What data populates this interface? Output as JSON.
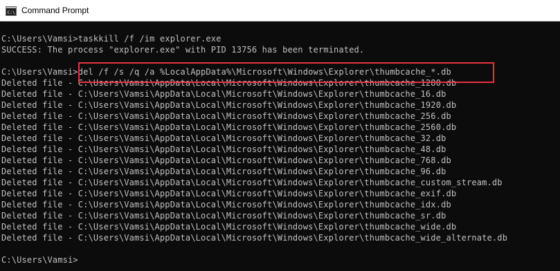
{
  "window": {
    "title": "Command Prompt",
    "icon": "cmd-icon",
    "highlight_color": "#e8323e"
  },
  "console": {
    "lines": [
      "",
      "C:\\Users\\Vamsi>taskkill /f /im explorer.exe",
      "SUCCESS: The process \"explorer.exe\" with PID 13756 has been terminated.",
      "",
      "C:\\Users\\Vamsi>del /f /s /q /a %LocalAppData%\\Microsoft\\Windows\\Explorer\\thumbcache_*.db",
      "Deleted file - C:\\Users\\Vamsi\\AppData\\Local\\Microsoft\\Windows\\Explorer\\thumbcache_1280.db",
      "Deleted file - C:\\Users\\Vamsi\\AppData\\Local\\Microsoft\\Windows\\Explorer\\thumbcache_16.db",
      "Deleted file - C:\\Users\\Vamsi\\AppData\\Local\\Microsoft\\Windows\\Explorer\\thumbcache_1920.db",
      "Deleted file - C:\\Users\\Vamsi\\AppData\\Local\\Microsoft\\Windows\\Explorer\\thumbcache_256.db",
      "Deleted file - C:\\Users\\Vamsi\\AppData\\Local\\Microsoft\\Windows\\Explorer\\thumbcache_2560.db",
      "Deleted file - C:\\Users\\Vamsi\\AppData\\Local\\Microsoft\\Windows\\Explorer\\thumbcache_32.db",
      "Deleted file - C:\\Users\\Vamsi\\AppData\\Local\\Microsoft\\Windows\\Explorer\\thumbcache_48.db",
      "Deleted file - C:\\Users\\Vamsi\\AppData\\Local\\Microsoft\\Windows\\Explorer\\thumbcache_768.db",
      "Deleted file - C:\\Users\\Vamsi\\AppData\\Local\\Microsoft\\Windows\\Explorer\\thumbcache_96.db",
      "Deleted file - C:\\Users\\Vamsi\\AppData\\Local\\Microsoft\\Windows\\Explorer\\thumbcache_custom_stream.db",
      "Deleted file - C:\\Users\\Vamsi\\AppData\\Local\\Microsoft\\Windows\\Explorer\\thumbcache_exif.db",
      "Deleted file - C:\\Users\\Vamsi\\AppData\\Local\\Microsoft\\Windows\\Explorer\\thumbcache_idx.db",
      "Deleted file - C:\\Users\\Vamsi\\AppData\\Local\\Microsoft\\Windows\\Explorer\\thumbcache_sr.db",
      "Deleted file - C:\\Users\\Vamsi\\AppData\\Local\\Microsoft\\Windows\\Explorer\\thumbcache_wide.db",
      "Deleted file - C:\\Users\\Vamsi\\AppData\\Local\\Microsoft\\Windows\\Explorer\\thumbcache_wide_alternate.db",
      "",
      "C:\\Users\\Vamsi>"
    ]
  }
}
